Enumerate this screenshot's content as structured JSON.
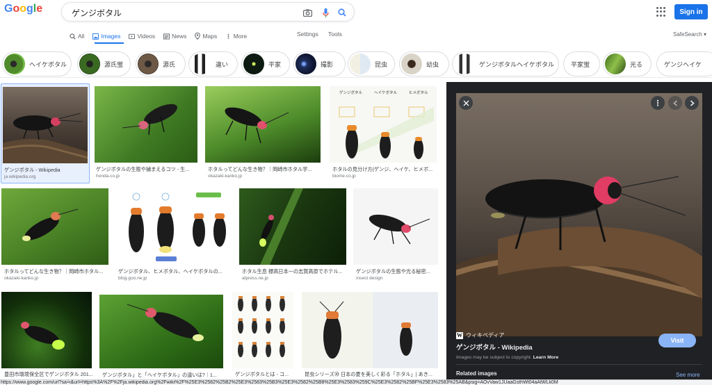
{
  "logo": "Google",
  "search": {
    "query": "ゲンジボタル"
  },
  "signin_label": "Sign in",
  "tabs": [
    {
      "label": "All",
      "icon": "search-icon"
    },
    {
      "label": "Images",
      "icon": "image-icon"
    },
    {
      "label": "Videos",
      "icon": "video-icon"
    },
    {
      "label": "News",
      "icon": "news-icon"
    },
    {
      "label": "Maps",
      "icon": "map-pin-icon"
    },
    {
      "label": "More",
      "icon": "more-vert-icon"
    }
  ],
  "settings_label": "Settings",
  "tools_label": "Tools",
  "safesearch_label": "SafeSearch ▾",
  "chips": [
    "ヘイケボタル",
    "源氏蛍",
    "源氏",
    "違い",
    "平家",
    "撮影",
    "昆虫",
    "幼虫",
    "ゲンジボタルヘイケボタル",
    "平家蛍",
    "光る",
    "ゲンジヘイケ"
  ],
  "results": [
    {
      "title": "ゲンジボタル - Wikipedia",
      "source": "ja.wikipedia.org"
    },
    {
      "title": "ゲンジボタルの生態や捕まえるコツ - 生...",
      "source": "honda.co.jp"
    },
    {
      "title": "ホタルってどんな生き物？｜岡崎市ホタル学...",
      "source": "okazaki-kanko.jp"
    },
    {
      "title": "ホタルの見分け方(ゲンジ、ヘイケ、ヒメボ...",
      "source": "biome.co.jp"
    },
    {
      "title": "ホタルってどんな生き物？｜岡崎市ホタル...",
      "source": "okazaki-kanko.jp"
    },
    {
      "title": "ゲンジボタル、ヒメボタル、ヘイケボタルの...",
      "source": "blog.goo.ne.jp"
    },
    {
      "title": "ホタル生息 標高日本一の志賀高原でホテル...",
      "source": "atpress.ne.jp"
    },
    {
      "title": "ゲンジボタルの生態や光る秘密...",
      "source": "insect design"
    },
    {
      "title": "豊田市環境保全区でゲンジボタル 201...",
      "source": ""
    },
    {
      "title": "ゲンジボタル」と「ヘイケボタル」の違いは?｜1...",
      "source": ""
    },
    {
      "title": "ゲンジボタルとは - コ...",
      "source": ""
    },
    {
      "title": "昆虫シリーズ⑳ 日本の夏を美しく彩る「ホタル」| あき...",
      "source": ""
    }
  ],
  "diagram_labels": {
    "genji": "ゲンジボタル",
    "heike": "ヘイケボタル",
    "hime": "ヒメボタル"
  },
  "panel": {
    "source": "ウィキペディア",
    "title": "ゲンジボタル - Wikipedia",
    "visit_label": "Visit",
    "copyright": "Images may be subject to copyright.",
    "learn_more": "Learn More",
    "related": "Related images",
    "see_more": "See more"
  },
  "status_url": "https://www.google.com/url?sa=i&url=https%3A%2F%2Fja.wikipedia.org%2Fwiki%2F%25E3%2582%25B2%25E3%2583%25B3%25E3%2582%25B8%25E3%2583%259C%25E3%2582%25BF%25E3%2583%25AB&psig=AOvVaw1JUaaGsthWt04aAtWLk0M",
  "colors": {
    "brand_blue": "#1a73e8",
    "panel_bg": "#202124",
    "link_blue": "#8ab4f8"
  }
}
